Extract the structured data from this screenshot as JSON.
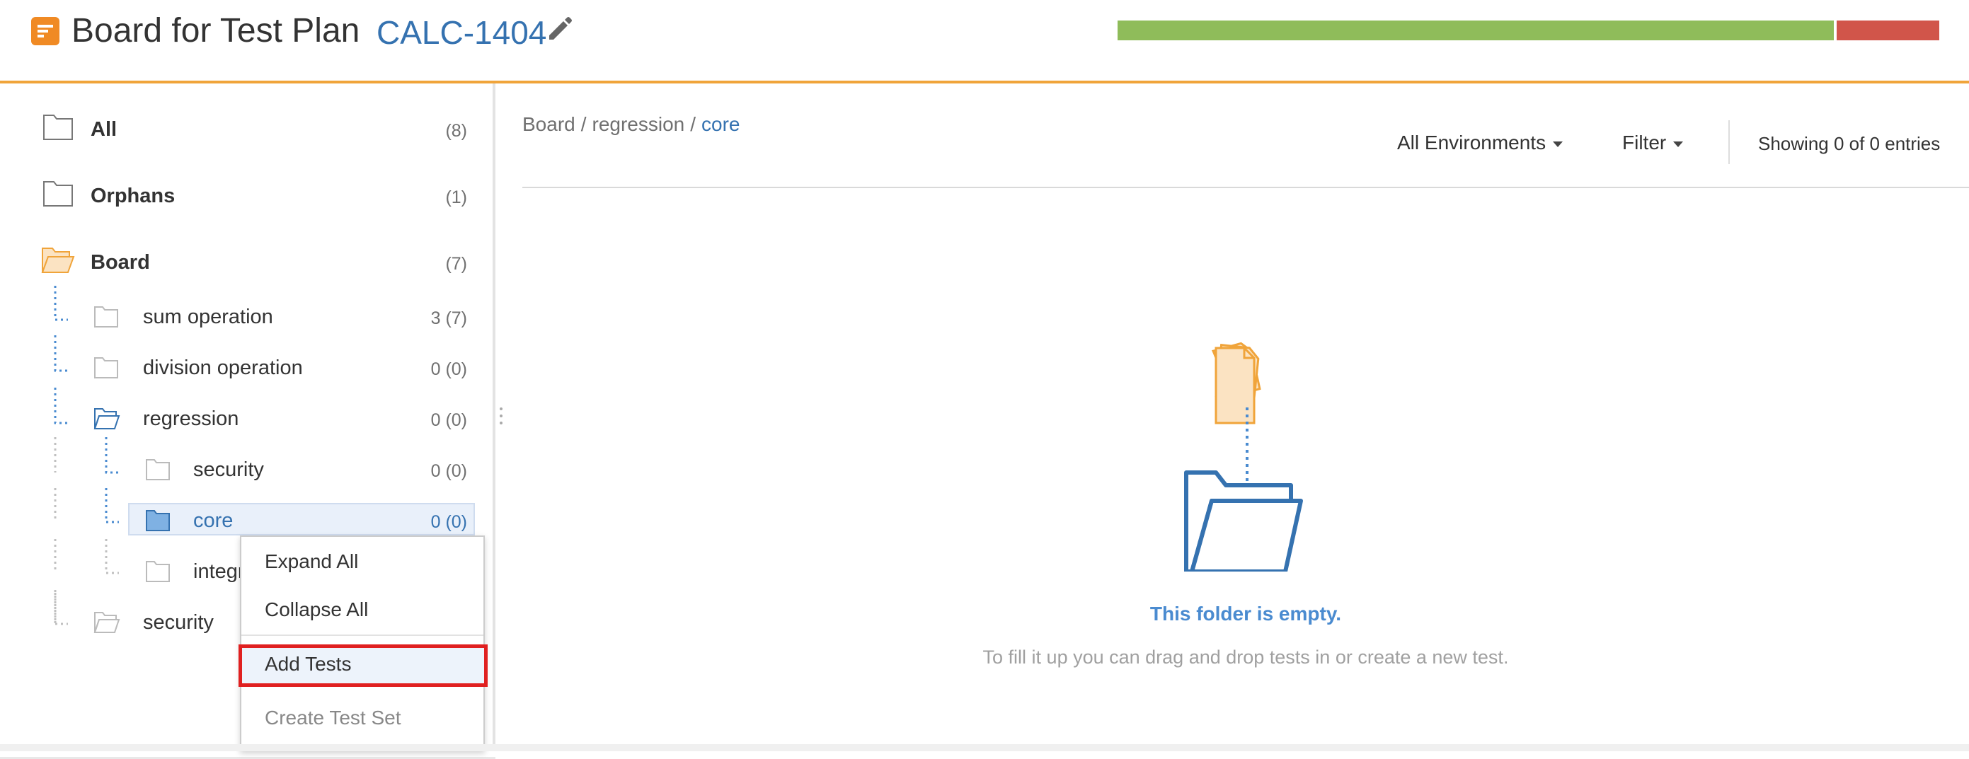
{
  "header": {
    "title": "Board for Test Plan",
    "issue_key": "CALC-1404",
    "progress": {
      "passed_fraction": 0.875,
      "failed_fraction": 0.125
    },
    "colors": {
      "accent": "#f0a43a",
      "passed": "#8fbc5a",
      "failed": "#d1554a",
      "link": "#3572b0"
    }
  },
  "tree": {
    "top_items": [
      {
        "label": "All",
        "count": "(8)",
        "icon": "folder-icon"
      },
      {
        "label": "Orphans",
        "count": "(1)",
        "icon": "folder-icon"
      },
      {
        "label": "Board",
        "count": "(7)",
        "icon": "folder-open-icon"
      }
    ],
    "children": [
      {
        "label": "sum operation",
        "count": "3 (7)"
      },
      {
        "label": "division operation",
        "count": "0 (0)"
      },
      {
        "label": "regression",
        "count": "0 (0)"
      },
      {
        "label": "security",
        "count": "0 (0)"
      },
      {
        "label": "core",
        "count": "0 (0)"
      },
      {
        "label": "integr",
        "count": ""
      },
      {
        "label": "security",
        "count": ""
      }
    ]
  },
  "context_menu": {
    "items": [
      {
        "label": "Expand All",
        "enabled": true
      },
      {
        "label": "Collapse All",
        "enabled": true
      },
      {
        "label": "Add Tests",
        "enabled": true
      },
      {
        "label": "Create Test Set",
        "enabled": false
      }
    ]
  },
  "main": {
    "breadcrumb": [
      "Board",
      "regression",
      "core"
    ],
    "environments_label": "All Environments",
    "filter_label": "Filter",
    "entries_text": "Showing 0 of 0 entries",
    "empty_title": "This folder is empty.",
    "empty_subtitle": "To fill it up you can drag and drop tests in or create a new test."
  }
}
